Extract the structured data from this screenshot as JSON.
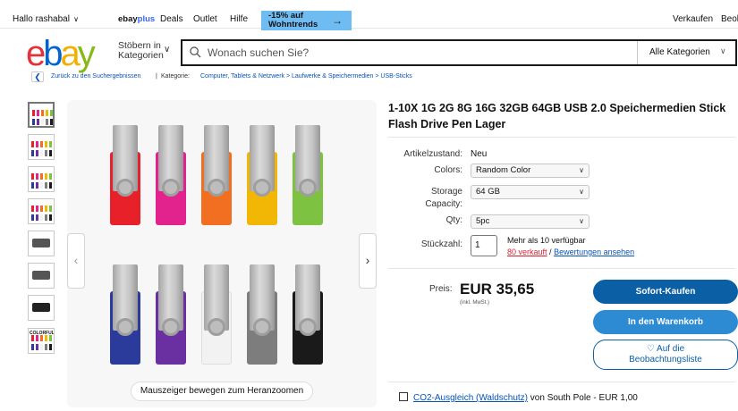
{
  "topbar": {
    "greeting": "Hallo rashabal",
    "ebayplus_a": "ebay",
    "ebayplus_b": "plus",
    "deals": "Deals",
    "outlet": "Outlet",
    "hilfe": "Hilfe",
    "promo_line1": "-15% auf",
    "promo_line2": "Wohntrends",
    "verkaufen": "Verkaufen",
    "beobachten": "Beol"
  },
  "header": {
    "browse_line1": "Stöbern in",
    "browse_line2": "Kategorien",
    "search_placeholder": "Wonach suchen Sie?",
    "category": "Alle Kategorien"
  },
  "breadcrumb": {
    "back": "Zurück zu den Suchergebnissen",
    "sep": "|",
    "kategorie_label": "Kategorie:",
    "path": "Computer, Tablets & Netzwerk  >  Laufwerke & Speichermedien  >  USB-Sticks"
  },
  "gallery": {
    "zoom_hint": "Mauszeiger bewegen zum Heranzoomen",
    "thumb_text": "COLORFUL",
    "colors_top": [
      "#e8202a",
      "#e2238d",
      "#f26f21",
      "#f2b705",
      "#7ec242"
    ],
    "colors_bottom": [
      "#2a3b9c",
      "#6a2fa0",
      "#f2f2f2",
      "#7d7d7d",
      "#1a1a1a"
    ]
  },
  "product": {
    "title": "1-10X 1G 2G 8G 16G 32GB 64GB USB 2.0 Speichermedien Stick Flash Drive Pen Lager",
    "condition_label": "Artikelzustand:",
    "condition_value": "Neu",
    "colors_label": "Colors:",
    "colors_value": "Random Color",
    "storage_label_1": "Storage",
    "storage_label_2": "Capacity:",
    "storage_value": "64 GB",
    "qty_label": "Qty:",
    "qty_value": "5pc",
    "stueck_label": "Stückzahl:",
    "stueck_value": "1",
    "avail_text": "Mehr als 10 verfügbar",
    "sold_text": "80 verkauft",
    "slash": "/",
    "reviews_text": "Bewertungen ansehen",
    "price_label": "Preis:",
    "price_value": "EUR 35,65",
    "price_note": "(inkl. MwSt.)",
    "buy_label": "Sofort-Kaufen",
    "cart_label": "In den Warenkorb",
    "watch_line1": "♡ Auf die",
    "watch_line2": "Beobachtungsliste",
    "co2_link": "CO2-Ausgleich (Waldschutz)",
    "co2_rest": " von South Pole - EUR 1,00"
  }
}
